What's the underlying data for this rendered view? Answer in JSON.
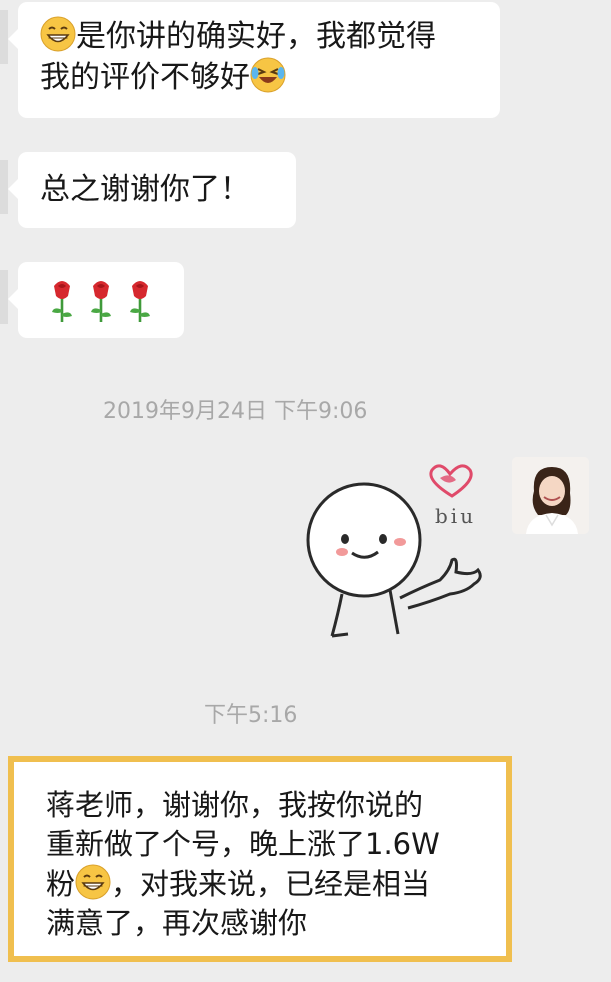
{
  "messages": [
    {
      "text_part1": "是你讲的确实好，我都觉得",
      "text_part2": "我的评价不够好",
      "leading_icon": "grinning-face-icon",
      "trailing_icon": "laughing-crying-face-icon"
    },
    {
      "text": "总之谢谢你了！"
    },
    {
      "content": "three rose emojis",
      "icon": "rose-icon",
      "count": 3
    }
  ],
  "timestamps": [
    "2019年9月24日 下午9:06",
    "下午5:16"
  ],
  "sticker": {
    "caption": "biu"
  },
  "highlight_message": {
    "line1": "蒋老师，谢谢你，我按你说的",
    "line2": "重新做了个号，晚上涨了1.6W",
    "line3_part1": "粉",
    "line3_part2": "，对我来说，已经是相当",
    "line4": "满意了，再次感谢你",
    "inline_icon": "grinning-face-icon",
    "border_color": "#f0bf4f"
  },
  "colors": {
    "background": "#ededed",
    "bubble": "#ffffff",
    "timestamp": "#a8a8a8",
    "highlight_border": "#f0bf4f"
  }
}
